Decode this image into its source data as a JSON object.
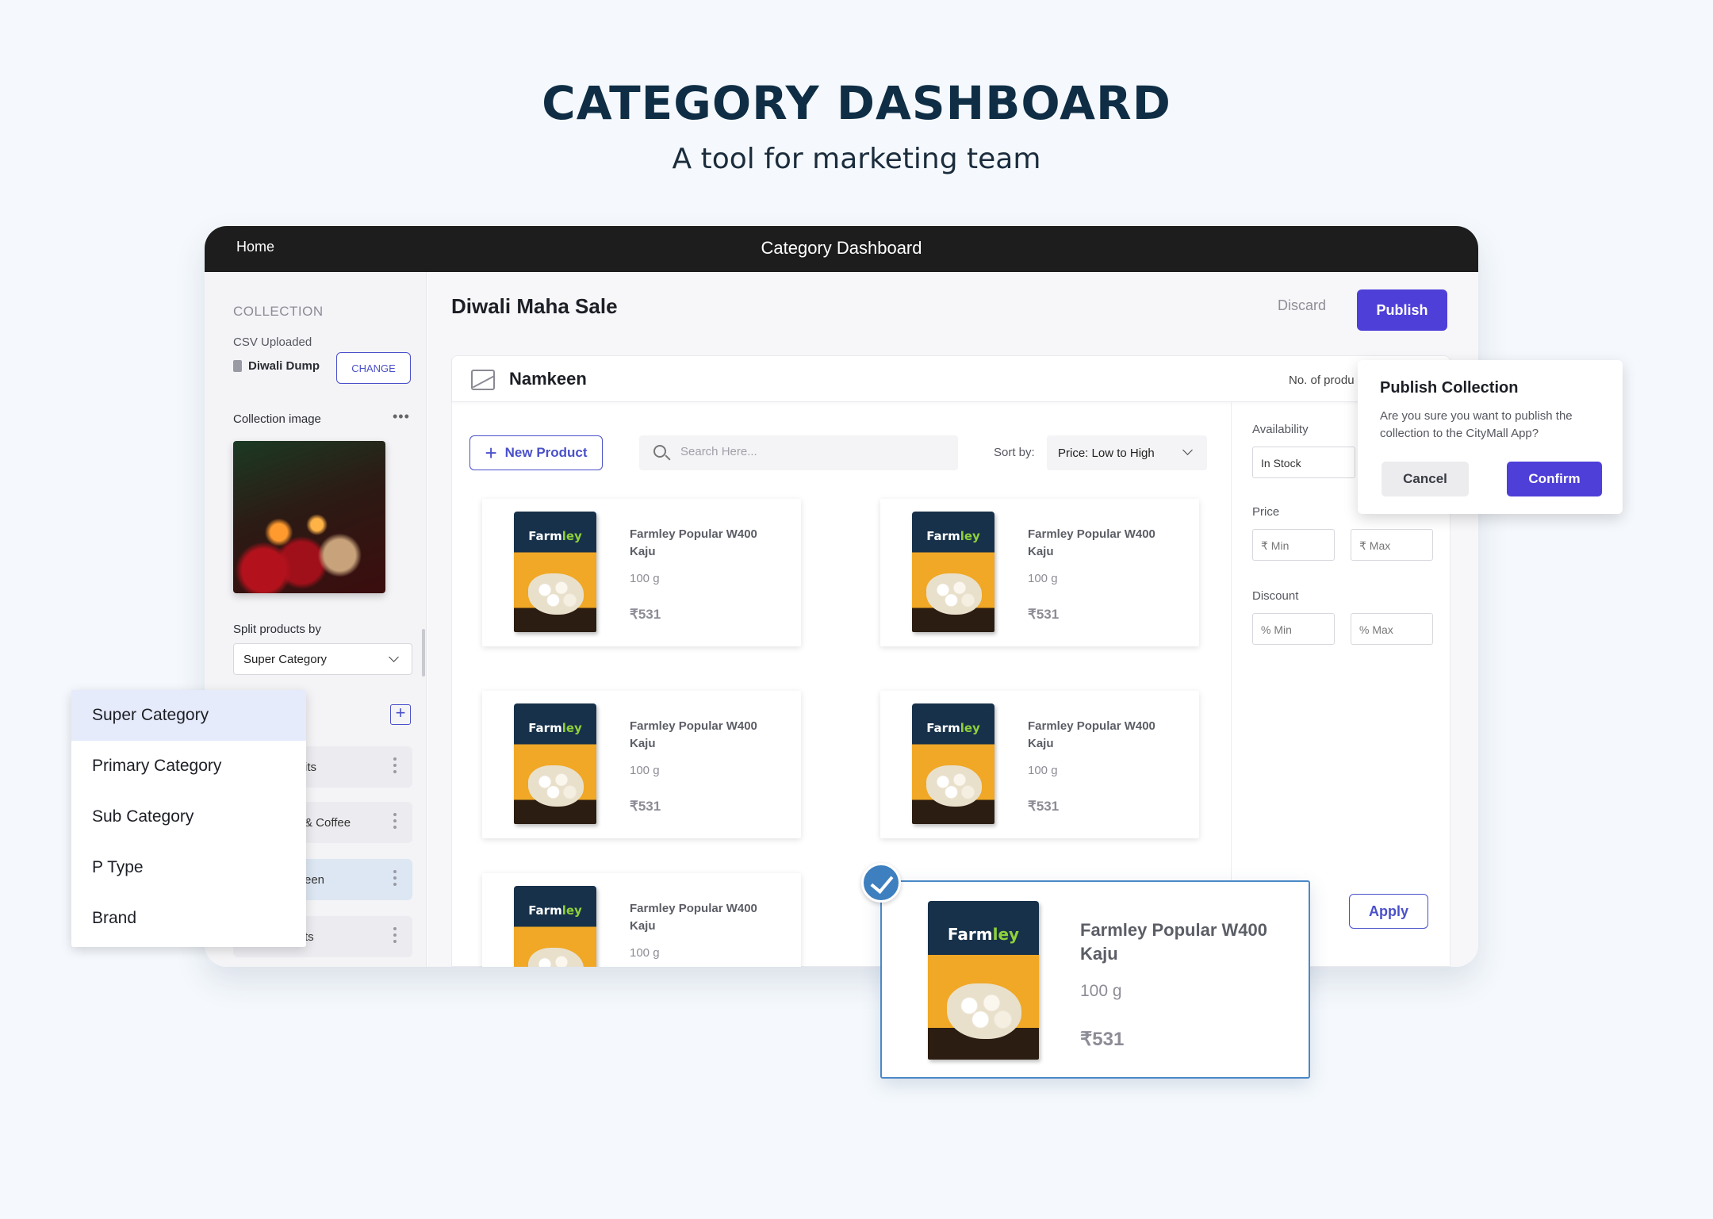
{
  "hero": {
    "title": "CATEGORY DASHBOARD",
    "subtitle": "A tool for marketing team"
  },
  "topbar": {
    "home": "Home",
    "title": "Category Dashboard"
  },
  "sidebar": {
    "section_label": "COLLECTION",
    "csv_label": "CSV Uploaded",
    "csv_file": "Diwali Dump",
    "change_label": "CHANGE",
    "image_label": "Collection image",
    "more_icon": "more-horizontal-icon",
    "split_label": "Split products by",
    "split_value": "Super Category",
    "add_icon": "plus-icon",
    "groups": [
      {
        "label": "its",
        "active": false
      },
      {
        "label": "& Coffee",
        "active": false
      },
      {
        "label": "een",
        "active": true
      },
      {
        "label": "ts",
        "active": false
      }
    ]
  },
  "main": {
    "page_title": "Diwali Maha Sale",
    "discard_label": "Discard",
    "publish_label": "Publish",
    "panel_title": "Namkeen",
    "no_products_label": "No. of produ",
    "new_product_label": "New Product",
    "search_placeholder": "Search Here...",
    "sort_label": "Sort by:",
    "sort_value": "Price: Low to High"
  },
  "filters": {
    "availability_label": "Availability",
    "availability_value": "In Stock",
    "price_label": "Price",
    "price_min": "₹ Min",
    "price_max": "₹ Max",
    "discount_label": "Discount",
    "discount_min": "% Min",
    "discount_max": "% Max",
    "apply_label": "Apply"
  },
  "products": [
    {
      "brand_a": "Farm",
      "brand_b": "ley",
      "name": "Farmley Popular W400 Kaju",
      "weight": "100 g",
      "price": "₹531"
    },
    {
      "brand_a": "Farm",
      "brand_b": "ley",
      "name": "Farmley Popular W400 Kaju",
      "weight": "100 g",
      "price": "₹531"
    },
    {
      "brand_a": "Farm",
      "brand_b": "ley",
      "name": "Farmley Popular W400 Kaju",
      "weight": "100 g",
      "price": "₹531"
    },
    {
      "brand_a": "Farm",
      "brand_b": "ley",
      "name": "Farmley Popular W400 Kaju",
      "weight": "100 g",
      "price": "₹531"
    },
    {
      "brand_a": "Farm",
      "brand_b": "ley",
      "name": "Farmley Popular W400 Kaju",
      "weight": "100 g",
      "price": ""
    }
  ],
  "selected_product": {
    "brand_a": "Farm",
    "brand_b": "ley",
    "name": "Farmley Popular W400 Kaju",
    "weight": "100 g",
    "price": "₹531",
    "check_icon": "check-circle-icon"
  },
  "publish_dialog": {
    "title": "Publish Collection",
    "message": "Are you sure you want to publish the collection to the CityMall App?",
    "cancel_label": "Cancel",
    "confirm_label": "Confirm"
  },
  "split_dropdown": {
    "options": [
      "Super Category",
      "Primary Category",
      "Sub Category",
      "P Type",
      "Brand"
    ],
    "selected": "Super Category"
  },
  "colors": {
    "primary": "#4e3fd8",
    "accent_blue": "#4a50c9",
    "topbar": "#1d1d1d",
    "check": "#3d7fbf"
  }
}
